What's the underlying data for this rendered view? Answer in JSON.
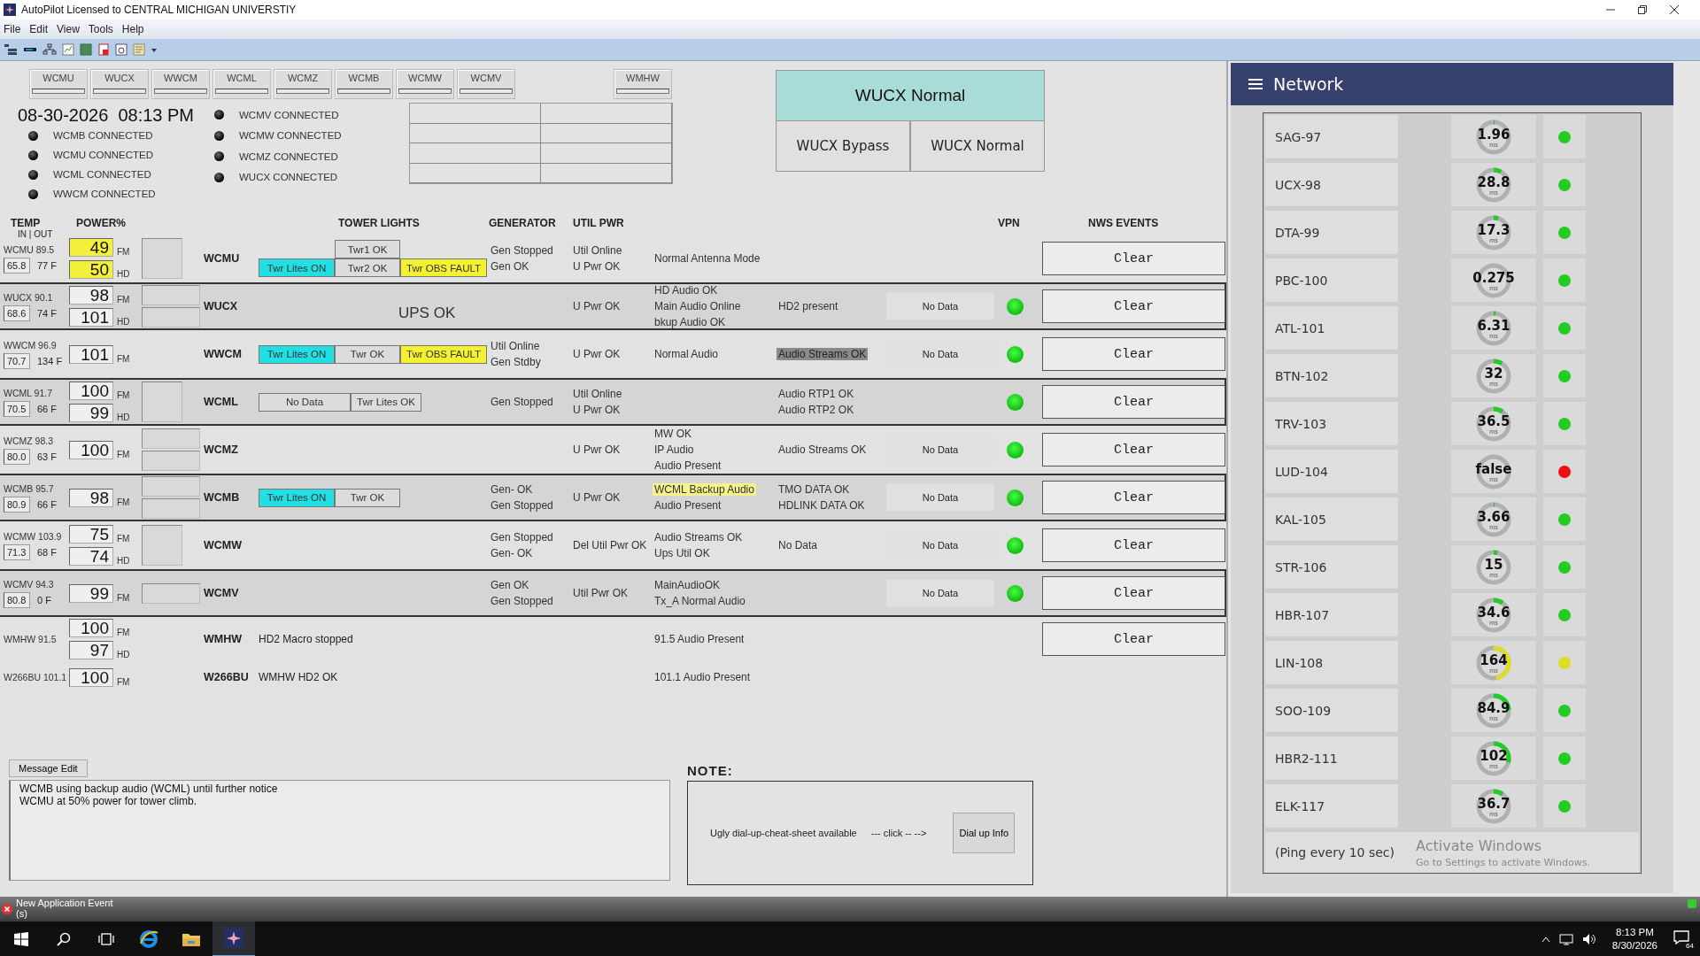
{
  "window": {
    "title": "AutoPilot Licensed to CENTRAL MICHIGAN UNIVERSTIY"
  },
  "menu": [
    "File",
    "Edit",
    "View",
    "Tools",
    "Help"
  ],
  "station_tiles": [
    "WCMU",
    "WUCX",
    "WWCM",
    "WCML",
    "WCMZ",
    "WCMB",
    "WCMW",
    "WCMV"
  ],
  "extra_tile": "WMHW",
  "date": "08-30-2026",
  "time": "08:13 PM",
  "connections": [
    [
      "WCMB CONNECTED",
      "WCMU CONNECTED",
      "WCML CONNECTED",
      "WWCM CONNECTED"
    ],
    [
      "WCMV CONNECTED",
      "WCMW CONNECTED",
      "WCMZ CONNECTED",
      "WUCX CONNECTED"
    ]
  ],
  "wucx_panel": {
    "status": "WUCX Normal",
    "buttons": [
      "WUCX Bypass",
      "WUCX Normal"
    ]
  },
  "columns": [
    {
      "label": "TEMP",
      "sublabel": "IN | OUT"
    },
    {
      "label": "POWER%"
    },
    {
      "label": "TOWER LIGHTS"
    },
    {
      "label": "GENERATOR"
    },
    {
      "label": "UTIL PWR"
    },
    {
      "label": "VPN"
    },
    {
      "label": "NWS EVENTS"
    }
  ],
  "stations": [
    {
      "temp_label": "WCMU 89.5",
      "temp_in": "65.8",
      "temp_out": "77 F",
      "power": [
        {
          "value": "49",
          "band": "FM",
          "alert": true
        },
        {
          "value": "50",
          "band": "HD",
          "alert": true
        }
      ],
      "indicators": [
        {
          "kind": "tall"
        }
      ],
      "name": "WCMU",
      "tower": [
        [
          {
            "label": "Twr1 OK",
            "kind": "ok"
          }
        ],
        [
          {
            "label": "Twr Lites ON",
            "kind": "on"
          },
          {
            "label": "Twr2 OK",
            "kind": "ok"
          },
          {
            "label": "Twr OBS FAULT",
            "kind": "fault"
          }
        ]
      ],
      "generator": [
        "Gen Stopped",
        "Gen OK"
      ],
      "util": [
        "Util Online",
        "U Pwr OK"
      ],
      "audio": [
        {
          "text": "Normal Antenna Mode",
          "kind": "plain"
        }
      ],
      "vpn": false,
      "bordered": false,
      "events": "Clear"
    },
    {
      "temp_label": "WUCX 90.1",
      "temp_in": "68.6",
      "temp_out": "74 F",
      "power": [
        {
          "value": "98",
          "band": "FM",
          "alert": false
        },
        {
          "value": "101",
          "band": "HD",
          "alert": false
        }
      ],
      "indicators": [
        {
          "kind": "short"
        },
        {
          "kind": "short"
        }
      ],
      "name": "WUCX",
      "ups": "UPS OK",
      "util": [
        "U Pwr OK"
      ],
      "audio": [
        {
          "text": "HD Audio OK",
          "kind": "plain"
        },
        {
          "text": "Main Audio Online",
          "kind": "plain"
        },
        {
          "text": "bkup Audio OK",
          "kind": "plain"
        }
      ],
      "audio_2": [
        {
          "text": "HD2 present",
          "kind": "plain"
        }
      ],
      "feed": "No Data",
      "vpn": true,
      "bordered": true,
      "events": "Clear"
    },
    {
      "temp_label": "WWCM 96.9",
      "temp_in": "70.7",
      "temp_out": "134 F",
      "power": [
        {
          "value": "101",
          "band": "FM",
          "alert": false
        }
      ],
      "name": "WWCM",
      "tower": [
        [
          {
            "label": "Twr Lites ON",
            "kind": "on"
          },
          {
            "label": "Twr OK",
            "kind": "ok"
          },
          {
            "label": "Twr OBS FAULT",
            "kind": "fault"
          }
        ]
      ],
      "generator": [
        "Util Online",
        "Gen Stdby"
      ],
      "util": [
        "U Pwr OK"
      ],
      "audio": [
        {
          "text": "Normal Audio",
          "kind": "plain"
        }
      ],
      "audio_2": [
        {
          "text": "Audio Streams OK",
          "kind": "dim"
        }
      ],
      "feed": "No Data",
      "vpn": true,
      "bordered": false,
      "events": "Clear"
    },
    {
      "temp_label": "WCML 91.7",
      "temp_in": "70.5",
      "temp_out": "66 F",
      "power": [
        {
          "value": "100",
          "band": "FM",
          "alert": false
        },
        {
          "value": "99",
          "band": "HD",
          "alert": false
        }
      ],
      "indicators": [
        {
          "kind": "tall"
        }
      ],
      "name": "WCML",
      "tower": [
        [
          {
            "label": "No Data",
            "kind": "wide"
          },
          {
            "label": "Twr Lites OK",
            "kind": "ok"
          }
        ]
      ],
      "generator": [
        "Gen Stopped"
      ],
      "util": [
        "Util Online",
        "U Pwr OK"
      ],
      "audio_2": [
        {
          "text": "Audio RTP1 OK",
          "kind": "plain"
        },
        {
          "text": "Audio RTP2 OK",
          "kind": "plain"
        }
      ],
      "vpn": true,
      "bordered": true,
      "events": "Clear"
    },
    {
      "temp_label": "WCMZ 98.3",
      "temp_in": "80.0",
      "temp_out": "63 F",
      "power": [
        {
          "value": "100",
          "band": "FM",
          "alert": false
        }
      ],
      "indicators": [
        {
          "kind": "short"
        },
        {
          "kind": "short"
        }
      ],
      "name": "WCMZ",
      "util": [
        "U Pwr OK"
      ],
      "audio": [
        {
          "text": "MW OK",
          "kind": "plain"
        },
        {
          "text": "IP Audio",
          "kind": "plain"
        },
        {
          "text": "Audio Present",
          "kind": "plain"
        }
      ],
      "audio_2": [
        {
          "text": "Audio Streams OK",
          "kind": "plain"
        }
      ],
      "feed": "No Data",
      "vpn": true,
      "bordered": false,
      "events": "Clear"
    },
    {
      "temp_label": "WCMB 95.7",
      "temp_in": "80.9",
      "temp_out": "66 F",
      "power": [
        {
          "value": "98",
          "band": "FM",
          "alert": false
        }
      ],
      "indicators": [
        {
          "kind": "short"
        },
        {
          "kind": "short"
        }
      ],
      "name": "WCMB",
      "tower": [
        [
          {
            "label": "Twr Lites ON",
            "kind": "on"
          },
          {
            "label": "Twr OK",
            "kind": "ok"
          }
        ]
      ],
      "generator": [
        "Gen- OK",
        "Gen Stopped"
      ],
      "util": [
        "U Pwr OK"
      ],
      "audio": [
        {
          "text": "WCML Backup Audio",
          "kind": "warning"
        },
        {
          "text": "Audio Present",
          "kind": "plain"
        }
      ],
      "audio_2": [
        {
          "text": "TMO DATA OK",
          "kind": "plain"
        },
        {
          "text": "HDLINK DATA OK",
          "kind": "plain"
        }
      ],
      "feed": "No Data",
      "vpn": true,
      "bordered": true,
      "events": "Clear"
    },
    {
      "temp_label": "WCMW 103.9",
      "temp_in": "71.3",
      "temp_out": "68 F",
      "power": [
        {
          "value": "75",
          "band": "FM",
          "alert": false
        },
        {
          "value": "74",
          "band": "HD",
          "alert": false
        }
      ],
      "indicators": [
        {
          "kind": "tall"
        }
      ],
      "name": "WCMW",
      "generator": [
        "Gen Stopped",
        "Gen- OK"
      ],
      "util": [
        "Del Util Pwr OK"
      ],
      "audio": [
        {
          "text": "Audio Streams OK",
          "kind": "plain"
        },
        {
          "text": "Ups Util OK",
          "kind": "plain"
        }
      ],
      "audio_2": [
        {
          "text": "No Data",
          "kind": "plain"
        }
      ],
      "feed": "No Data",
      "vpn": true,
      "bordered": false,
      "events": "Clear"
    },
    {
      "temp_label": "WCMV 94.3",
      "temp_in": "80.8",
      "temp_out": "0 F",
      "power": [
        {
          "value": "99",
          "band": "FM",
          "alert": false
        }
      ],
      "indicators": [
        {
          "kind": "short"
        }
      ],
      "name": "WCMV",
      "generator": [
        "Gen OK",
        "Gen Stopped"
      ],
      "util": [
        "Util Pwr OK"
      ],
      "audio": [
        {
          "text": "MainAudioOK",
          "kind": "plain"
        },
        {
          "text": "Tx_A Normal Audio",
          "kind": "plain"
        }
      ],
      "feed": "No Data",
      "vpn": true,
      "bordered": true,
      "events": "Clear"
    },
    {
      "temp_label": "WMHW 91.5",
      "power": [
        {
          "value": "100",
          "band": "FM",
          "alert": false
        },
        {
          "value": "97",
          "band": "HD",
          "alert": false
        }
      ],
      "name": "WMHW",
      "tower_note": "HD2 Macro stopped",
      "audio": [
        {
          "text": "91.5 Audio Present",
          "kind": "plain"
        }
      ],
      "vpn": false,
      "bordered": false,
      "events": "Clear"
    },
    {
      "temp_label": "W266BU 101.1",
      "power": [
        {
          "value": "100",
          "band": "FM",
          "alert": false
        }
      ],
      "name": "W266BU",
      "tower_note": "WMHW HD2 OK",
      "audio": [
        {
          "text": "101.1 Audio Present",
          "kind": "plain"
        }
      ],
      "vpn": false,
      "bordered": false
    }
  ],
  "message": {
    "button": "Message Edit",
    "lines": [
      "WCMB using backup audio (WCML) until further notice",
      "WCMU at 50% power for tower climb."
    ]
  },
  "note": {
    "title": "NOTE:",
    "text": "Ugly dial-up-cheat-sheet available",
    "hint": "--- click  -- -->",
    "button": "Dial up Info"
  },
  "network": {
    "title": "Network",
    "hosts": [
      {
        "name": "SAG-97",
        "ping": "1.96",
        "unit": "ms",
        "level": 0.01,
        "color": "#22cc22"
      },
      {
        "name": "UCX-98",
        "ping": "28.8",
        "unit": "ms",
        "level": 0.08,
        "color": "#22cc22"
      },
      {
        "name": "DTA-99",
        "ping": "17.3",
        "unit": "ms",
        "level": 0.05,
        "color": "#22cc22"
      },
      {
        "name": "PBC-100",
        "ping": "0.275",
        "unit": "ms",
        "level": 0,
        "color": "#22cc22"
      },
      {
        "name": "ATL-101",
        "ping": "6.31",
        "unit": "ms",
        "level": 0.02,
        "color": "#22cc22"
      },
      {
        "name": "BTN-102",
        "ping": "32",
        "unit": "ms",
        "level": 0.09,
        "color": "#22cc22"
      },
      {
        "name": "TRV-103",
        "ping": "36.5",
        "unit": "ms",
        "level": 0.1,
        "color": "#22cc22"
      },
      {
        "name": "LUD-104",
        "ping": "false",
        "unit": "ms",
        "level": 0,
        "color": "#ee1111"
      },
      {
        "name": "KAL-105",
        "ping": "3.66",
        "unit": "ms",
        "level": 0.01,
        "color": "#22cc22"
      },
      {
        "name": "STR-106",
        "ping": "15",
        "unit": "ms",
        "level": 0.04,
        "color": "#22cc22"
      },
      {
        "name": "HBR-107",
        "ping": "34.6",
        "unit": "ms",
        "level": 0.1,
        "color": "#22cc22"
      },
      {
        "name": "LIN-108",
        "ping": "164",
        "unit": "ms",
        "level": 0.47,
        "color": "#dddd22"
      },
      {
        "name": "SOO-109",
        "ping": "84.9",
        "unit": "ms",
        "level": 0.24,
        "color": "#22cc22"
      },
      {
        "name": "HBR2-111",
        "ping": "102",
        "unit": "ms",
        "level": 0.29,
        "color": "#22cc22"
      },
      {
        "name": "ELK-117",
        "ping": "36.7",
        "unit": "ms",
        "level": 0.1,
        "color": "#22cc22"
      }
    ],
    "footer": "(Ping every 10 sec)"
  },
  "activation": {
    "title": "Activate Windows",
    "hint": "Go to Settings to activate Windows."
  },
  "status_bar": {
    "event": "New Application Event",
    "sub": "(s)"
  },
  "taskbar": {
    "time": "8:13 PM",
    "date": "8/30/2026",
    "notifications": "64"
  }
}
